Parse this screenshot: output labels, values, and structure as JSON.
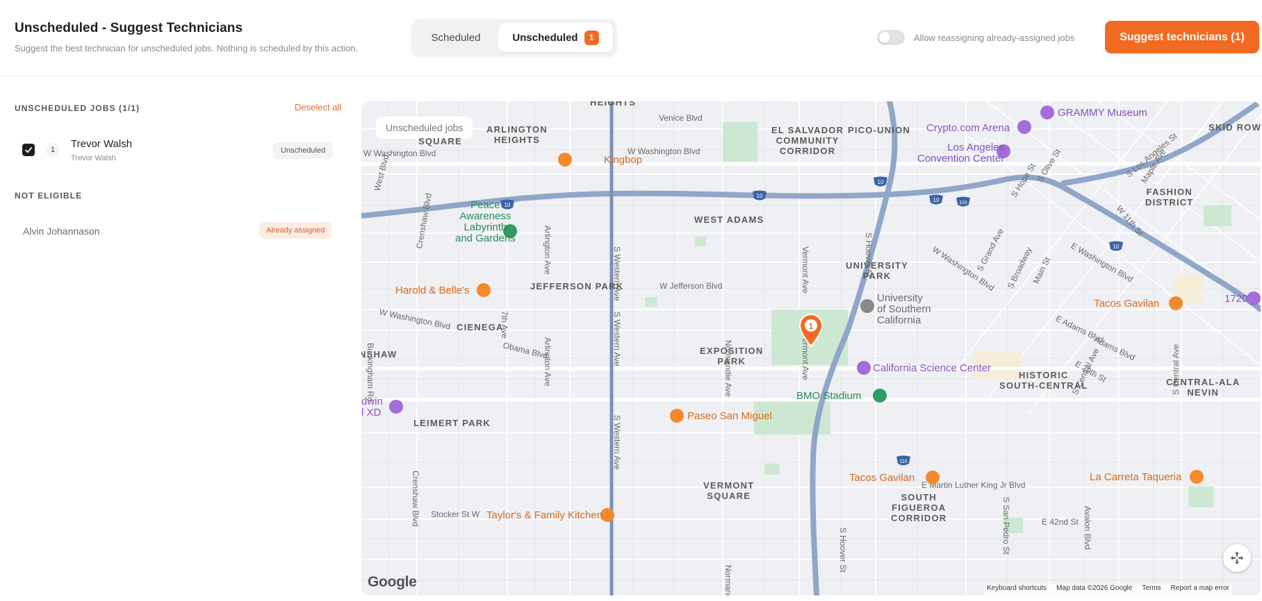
{
  "header": {
    "title": "Unscheduled - Suggest Technicians",
    "subtitle": "Suggest the best technician for unscheduled jobs. Nothing is scheduled by this action.",
    "tabs": [
      {
        "label": "Scheduled",
        "active": false
      },
      {
        "label": "Unscheduled",
        "active": true,
        "badge": "1"
      }
    ],
    "toggle": {
      "label": "Allow reassigning already-assigned jobs",
      "on": false
    },
    "suggest_button": "Suggest technicians (1)"
  },
  "sidebar": {
    "unscheduled_label": "UNSCHEDULED JOBS (1/1)",
    "deselect_all": "Deselect all",
    "jobs": [
      {
        "number": "1",
        "name": "Trevor Walsh",
        "sub": "Trevor Walsh",
        "status": "Unscheduled",
        "checked": true
      }
    ],
    "not_eligible_label": "NOT ELIGIBLE",
    "not_eligible": [
      {
        "name": "Alvin Johannason",
        "status": "Already assigned"
      }
    ]
  },
  "map": {
    "chip": "Unscheduled jobs",
    "marker_label": "1",
    "districts": {
      "heights": "HEIGHTS",
      "arlington_heights": "ARLINGTON\nHEIGHTS",
      "square": "SQUARE",
      "el_salvador": "EL SALVADOR\nCOMMUNITY\nCORRIDOR",
      "pico_union": "PICO-UNION",
      "skid_row": "SKID ROW",
      "fashion_district": "FASHION\nDISTRICT",
      "west_adams": "WEST ADAMS",
      "university_park": "UNIVERSITY\nPARK",
      "jefferson_park": "JEFFERSON PARK",
      "cienega": "CIENEGA",
      "nshaw": "NSHAW",
      "exposition_park": "EXPOSITION\nPARK",
      "historic_south_central": "HISTORIC\nSOUTH-CENTRAL",
      "central_alameda": "CENTRAL-ALA\nNEVIN",
      "leimert_park": "LEIMERT PARK",
      "vermont_square": "VERMONT\nSQUARE",
      "south_figueroa": "SOUTH\nFIGUEROA\nCORRIDOR"
    },
    "streets": {
      "venice": "Venice Blvd",
      "w_washington": "W Washington Blvd",
      "w_washington_top": "W Washington Blvd",
      "w_jefferson": "W Jefferson Blvd",
      "w_washington_right": "W Washington Blvd",
      "e_washington": "E Washington Blvd",
      "adams": "Adams Blvd",
      "e_adams": "E Adams Blvd",
      "obama": "Obama Blvd",
      "w_washington_sw": "W Washington Blvd",
      "mlk": "E Martin Luther King Jr Blvd",
      "e42": "E 42nd St",
      "stocker": "Stocker St W",
      "s_western": "S Western Ave",
      "s_western2": "S Western Ave",
      "s_western3": "S Western Ave",
      "vermont": "Vermont Ave",
      "vermont2": "Vermont Ave",
      "s_hoover": "S Hoover St",
      "s_hoover2": "S Hoover St",
      "arlington": "Arlington Ave",
      "arlington2": "Arlington Ave",
      "normandie": "Normandie Ave",
      "normandie2": "Normandie Ave",
      "s_7th": "7th Ave",
      "crenshaw": "Crenshaw Blvd",
      "crenshaw2": "Crenshaw Blvd",
      "buckingham": "Buckingham Rd",
      "west_blvd": "West Blvd",
      "s_grand": "S Grand Ave",
      "s_central": "S Central Ave",
      "s_olive": "S Olive St",
      "s_hope": "S Hope St",
      "w_11th": "W 11th St",
      "maple": "Maple Ave",
      "s_broadway": "S Broadway",
      "main": "Main St",
      "s_los_angeles": "S Los Angeles St",
      "e29": "E 29th St",
      "s_san_pedro": "S San Pedro St",
      "avalon": "Avalon Blvd",
      "s_central2": "S Central Ave"
    },
    "pois": {
      "grammy": "GRAMMY Museum",
      "crypto": "Crypto.com Arena",
      "lacc": "Los Angeles\nConvention Center",
      "kingbop": "Kingbop",
      "peace": "Peace\nAwareness\nLabyrinth\nand Gardens",
      "harold": "Harold & Belle's",
      "usc": "University\nof Southern\nCalifornia",
      "tacos_gavilan_1": "Tacos Gavilan",
      "tacos_gavilan_2": "Tacos Gavilan",
      "science": "California Science Center",
      "bmo": "BMO Stadium",
      "paseo": "Paseo San Miguel",
      "la_carreta": "La Carreta Taqueria",
      "baldwin": "dwin\nl XD",
      "taylors": "Taylor's & Family Kitchen",
      "ns1720": "1720"
    },
    "highways": [
      "10",
      "10",
      "10",
      "10",
      "10",
      "110",
      "110"
    ],
    "google_logo": "Google",
    "footer": {
      "shortcuts": "Keyboard shortcuts",
      "data": "Map data ©2026 Google",
      "terms": "Terms",
      "report": "Report a map error"
    }
  }
}
